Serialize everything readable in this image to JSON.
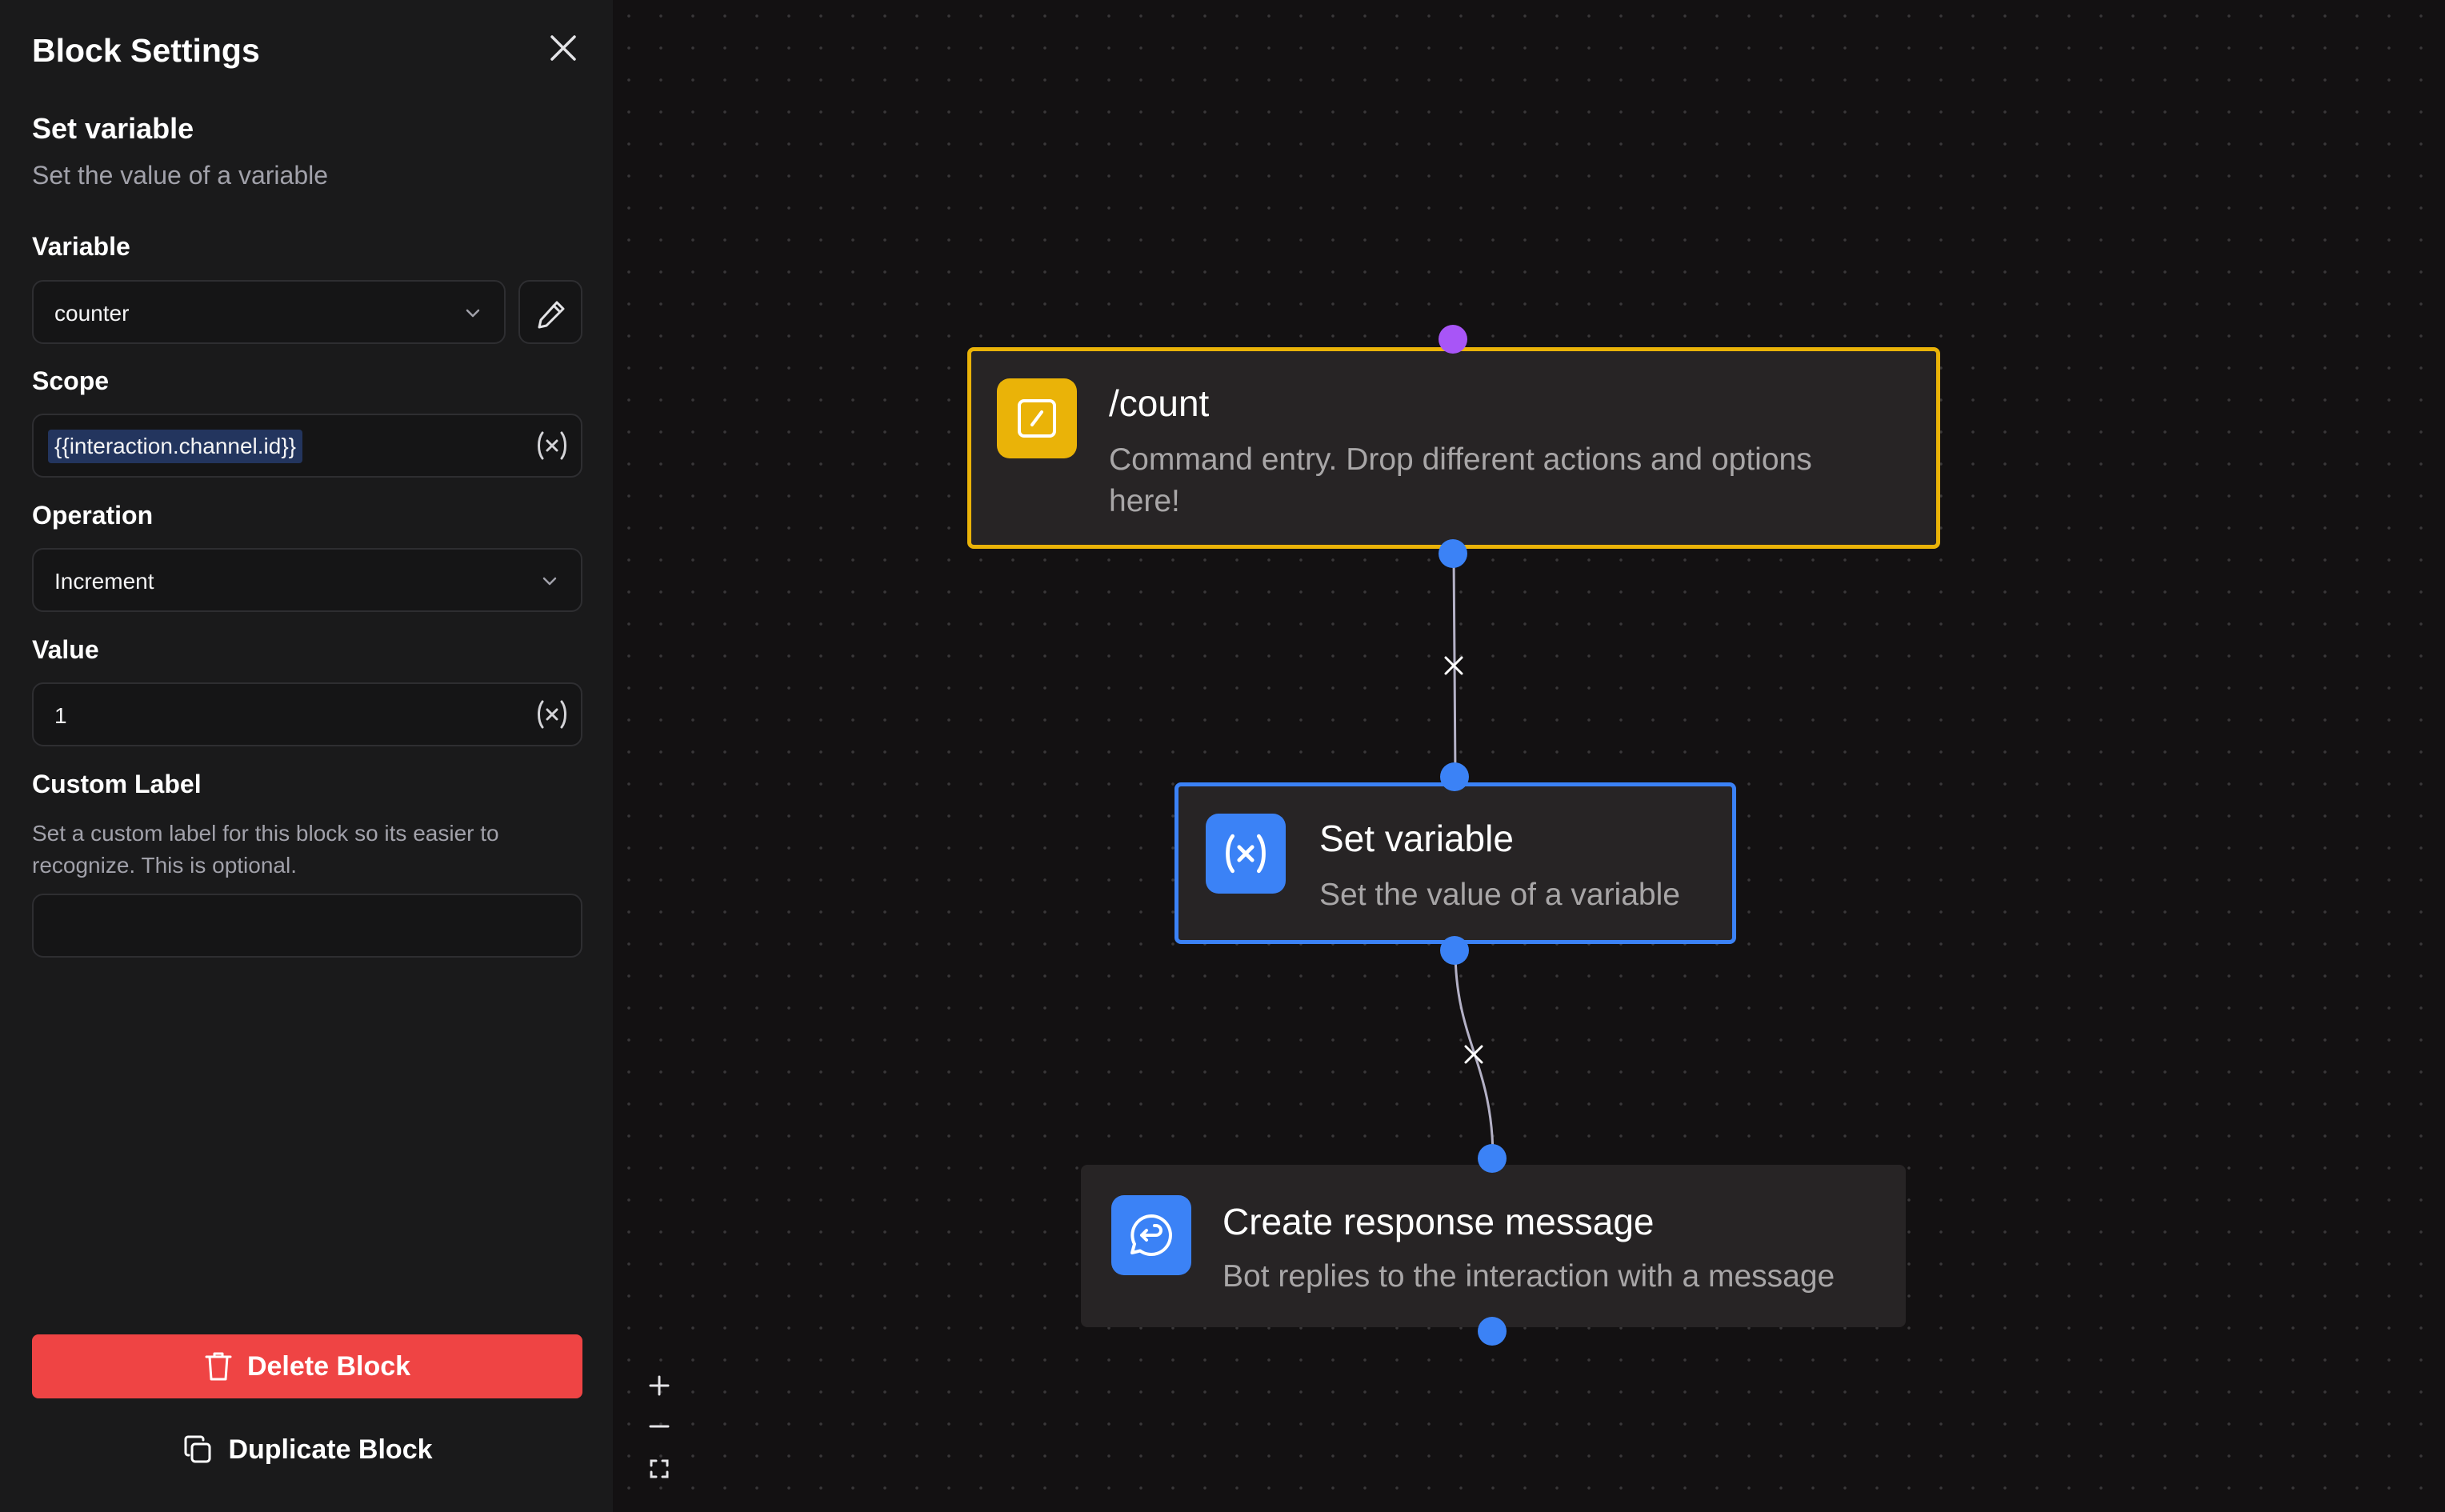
{
  "sidebar": {
    "title": "Block Settings",
    "block_name": "Set variable",
    "block_description": "Set the value of a variable",
    "variable": {
      "label": "Variable",
      "value": "counter"
    },
    "scope": {
      "label": "Scope",
      "value": "{{interaction.channel.id}}"
    },
    "operation": {
      "label": "Operation",
      "value": "Increment"
    },
    "value_field": {
      "label": "Value",
      "value": "1"
    },
    "custom_label": {
      "label": "Custom Label",
      "help": "Set a custom label for this block so its easier to recognize. This is optional.",
      "value": ""
    },
    "delete_label": "Delete Block",
    "duplicate_label": "Duplicate Block"
  },
  "canvas": {
    "nodes": [
      {
        "title": "/count",
        "description": "Command entry. Drop different actions and options here!",
        "icon": "slash-command-icon",
        "accent": "#eab308"
      },
      {
        "title": "Set variable",
        "description": "Set the value of a variable",
        "icon": "variable-icon",
        "accent": "#3b82f6"
      },
      {
        "title": "Create response message",
        "description": "Bot replies to the interaction with a message",
        "icon": "reply-message-icon",
        "accent": "#3b82f6"
      }
    ],
    "controls": {
      "zoom_in": "+",
      "zoom_out": "−",
      "fit_view": "fit"
    }
  },
  "colors": {
    "delete": "#ef4444",
    "entry_border": "#eab308",
    "selected_border": "#3b82f6",
    "handle": "#3b82f6",
    "entry_handle": "#a855f7"
  }
}
